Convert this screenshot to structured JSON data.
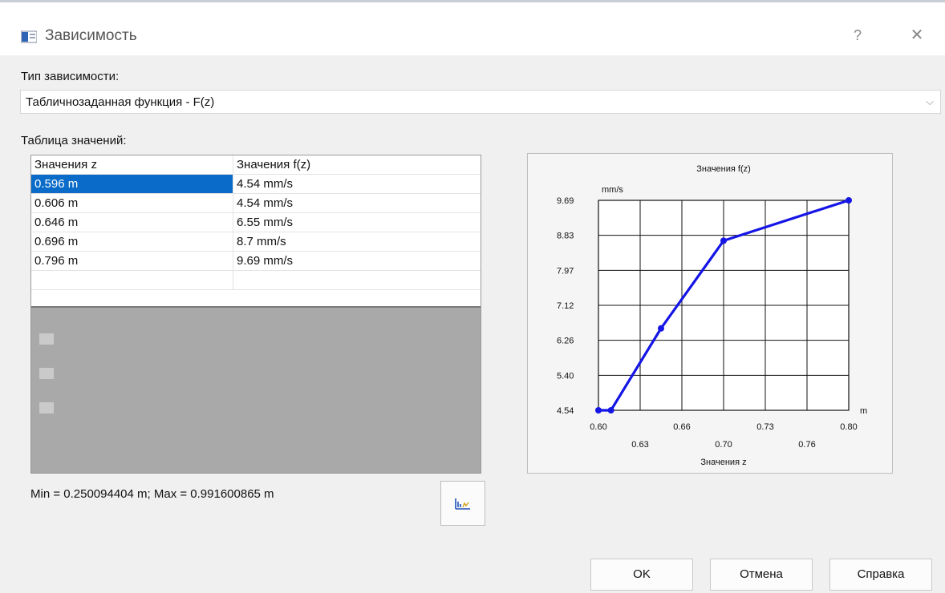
{
  "window": {
    "title": "Зависимость",
    "help_label": "?",
    "close_label": "✕"
  },
  "dependency_type": {
    "label": "Тип зависимости:",
    "selected": "Табличнозаданная функция - F(z)"
  },
  "table": {
    "label": "Таблица значений:",
    "headers": [
      "Значения z",
      "Значения f(z)"
    ],
    "rows": [
      [
        "0.596 m",
        "4.54 mm/s"
      ],
      [
        "0.606 m",
        "4.54 mm/s"
      ],
      [
        "0.646 m",
        "6.55 mm/s"
      ],
      [
        "0.696 m",
        "8.7 mm/s"
      ],
      [
        "0.796 m",
        "9.69 mm/s"
      ]
    ],
    "selected_row": 0
  },
  "range_text": "Min = 0.250094404 m; Max = 0.991600865 m",
  "icons": {
    "app": "app-window-icon",
    "chart_button": "chart-icon"
  },
  "colors": {
    "selection": "#0a6cc8",
    "series": "#1515e6"
  },
  "buttons": {
    "ok": "OK",
    "cancel": "Отмена",
    "help": "Справка"
  },
  "chart_data": {
    "type": "line",
    "title": "Значения f(z)",
    "xlabel": "Значения z",
    "ylabel": "",
    "x_unit": "m",
    "y_unit": "mm/s",
    "xlim": [
      0.596,
      0.796
    ],
    "ylim": [
      4.54,
      9.69
    ],
    "x_ticks_upper": [
      "0.60",
      "0.66",
      "0.73",
      "0.80"
    ],
    "x_ticks_lower": [
      "0.63",
      "0.70",
      "0.76"
    ],
    "y_ticks": [
      "9.69",
      "8.83",
      "7.97",
      "7.12",
      "6.26",
      "5.40",
      "4.54"
    ],
    "grid": true,
    "series": [
      {
        "x": [
          0.596,
          0.606,
          0.646,
          0.696,
          0.796
        ],
        "y": [
          4.54,
          4.54,
          6.55,
          8.7,
          9.69
        ]
      }
    ]
  }
}
